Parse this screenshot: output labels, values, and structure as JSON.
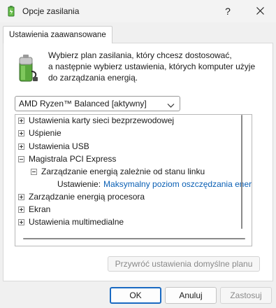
{
  "window": {
    "title": "Opcje zasilania",
    "help_glyph": "?"
  },
  "tabs": [
    {
      "label": "Ustawienia zaawansowane"
    }
  ],
  "description": {
    "line1": "Wybierz plan zasilania, który chcesz dostosować,",
    "line2": "a następnie wybierz ustawienia, których komputer użyje",
    "line3": "do zarządzania energią."
  },
  "plan_select": {
    "value": "AMD Ryzen™ Balanced [aktywny]"
  },
  "tree": {
    "items": [
      {
        "label": "Ustawienia karty sieci bezprzewodowej",
        "expander": "+"
      },
      {
        "label": "Uśpienie",
        "expander": "+"
      },
      {
        "label": "Ustawienia USB",
        "expander": "+"
      },
      {
        "label": "Magistrala PCI Express",
        "expander": "−"
      },
      {
        "label": "Zarządzanie energią zależnie od stanu linku",
        "expander": "−"
      },
      {
        "label": "Zarządzanie energią procesora",
        "expander": "+"
      },
      {
        "label": "Ekran",
        "expander": "+"
      },
      {
        "label": "Ustawienia multimedialne",
        "expander": "+"
      }
    ],
    "setting": {
      "label": "Ustawienie:",
      "value": "Maksymalny poziom oszczędzania energ"
    }
  },
  "buttons": {
    "restore": "Przywróć ustawienia domyślne planu",
    "ok": "OK",
    "cancel": "Anuluj",
    "apply": "Zastosuj"
  },
  "colors": {
    "link": "#0a5fb4",
    "accent": "#1a6ac2",
    "disabled_text": "#8a8a8a"
  },
  "icons": {
    "app": "power-options-icon",
    "close": "close-icon",
    "battery": "battery-plug-icon",
    "dropdown": "chevron-down-icon"
  }
}
